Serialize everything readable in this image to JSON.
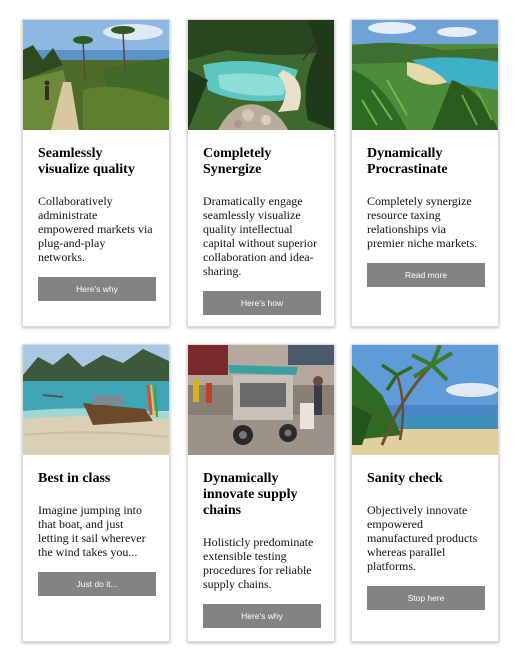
{
  "cards": [
    {
      "title": "Seamlessly visualize quality",
      "text": "Collaboratively administrate empowered markets via plug-and-play networks.",
      "button": "Here's why",
      "image": "forest-trail-photo"
    },
    {
      "title": "Completely Synergize",
      "text": "Dramatically engage seamlessly visualize quality intellectual capital without superior collaboration and idea-sharing.",
      "button": "Here's how",
      "image": "turquoise-bay-photo"
    },
    {
      "title": "Dynamically Procrastinate",
      "text": "Completely synergize resource taxing relationships via premier niche markets.",
      "button": "Read more",
      "image": "coastal-ferns-photo"
    },
    {
      "title": "Best in class",
      "text": "Imagine jumping into that boat, and just letting it sail wherever the wind takes you...",
      "button": "Just do it...",
      "image": "longtail-boat-photo"
    },
    {
      "title": "Dynamically innovate supply chains",
      "text": "Holisticly predominate extensible testing procedures for reliable supply chains.",
      "button": "Here's why",
      "image": "street-market-photo"
    },
    {
      "title": "Sanity check",
      "text": "Objectively innovate empowered manufactured products whereas parallel platforms.",
      "button": "Stop here",
      "image": "palm-beach-photo"
    }
  ],
  "colors": {
    "button_bg": "#838383",
    "button_text": "#ffffff",
    "card_border": "#dcdcdc"
  }
}
